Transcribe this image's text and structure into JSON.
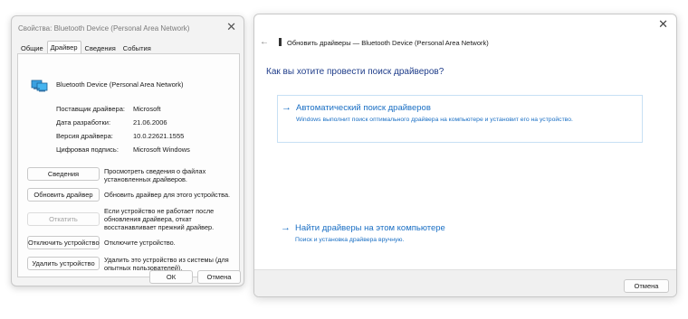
{
  "props_dialog": {
    "title": "Свойства: Bluetooth Device (Personal Area Network)",
    "close_glyph": "✕",
    "tabs": [
      {
        "label": "Общие"
      },
      {
        "label": "Драйвер"
      },
      {
        "label": "Сведения"
      },
      {
        "label": "События"
      }
    ],
    "active_tab": "Драйвер",
    "device_name": "Bluetooth Device (Personal Area Network)",
    "info": [
      {
        "key": "Поставщик драйвера:",
        "value": "Microsoft"
      },
      {
        "key": "Дата разработки:",
        "value": "21.06.2006"
      },
      {
        "key": "Версия драйвера:",
        "value": "10.0.22621.1555"
      },
      {
        "key": "Цифровая подпись:",
        "value": "Microsoft Windows"
      }
    ],
    "buttons": [
      {
        "label": "Сведения",
        "desc": "Просмотреть сведения о файлах установленных драйверов.",
        "enabled": true
      },
      {
        "label": "Обновить драйвер",
        "desc": "Обновить драйвер для этого устройства.",
        "enabled": true
      },
      {
        "label": "Откатить",
        "desc": "Если устройство не работает после обновления драйвера, откат восстанавливает прежний драйвер.",
        "enabled": false
      },
      {
        "label": "Отключить устройство",
        "desc": "Отключите устройство.",
        "enabled": true
      },
      {
        "label": "Удалить устройство",
        "desc": "Удалить это устройство из системы (для опытных пользователей).",
        "enabled": true
      }
    ],
    "ok_label": "ОК",
    "cancel_label": "Отмена"
  },
  "wizard": {
    "close_glyph": "✕",
    "back_glyph": "←",
    "title": "Обновить драйверы — Bluetooth Device (Personal Area Network)",
    "question": "Как вы хотите провести поиск драйверов?",
    "option_auto": {
      "arrow": "→",
      "title": "Автоматический поиск драйверов",
      "desc": "Windows выполнит поиск оптимального драйвера на компьютере и установит его на устройство."
    },
    "option_manual": {
      "arrow": "→",
      "title": "Найти драйверы на этом компьютере",
      "desc": "Поиск и установка драйвера вручную."
    },
    "cancel_label": "Отмена"
  },
  "colors": {
    "link_blue": "#1a6fc4",
    "heading_blue": "#1f3d8a",
    "option_border": "#c7e0f4"
  }
}
